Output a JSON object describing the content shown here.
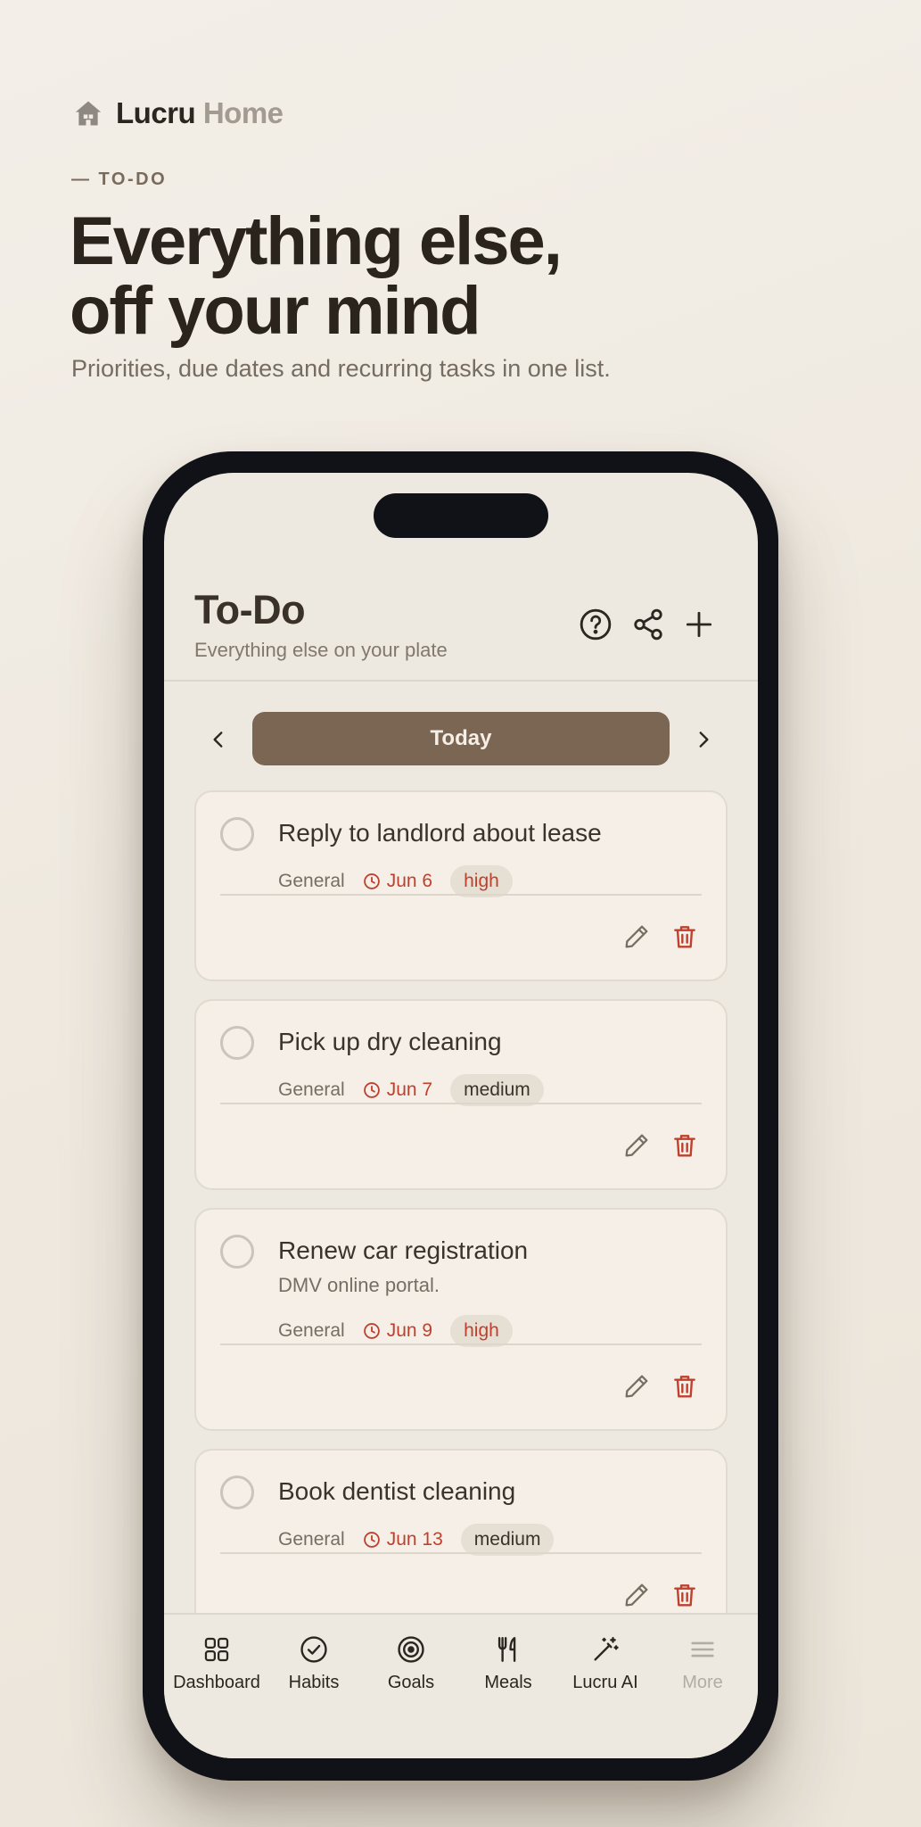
{
  "brand": {
    "name_part1": "Lucru",
    "name_part2": "Home"
  },
  "hero": {
    "eyebrow": "— TO-DO",
    "headline_line1": "Everything else,",
    "headline_line2": "off your mind",
    "subhead": "Priorities, due dates and recurring tasks in one list."
  },
  "app": {
    "title": "To-Do",
    "subtitle": "Everything else on your plate",
    "header_icons": [
      "help-icon",
      "share-icon",
      "plus-icon"
    ],
    "date_nav": {
      "label": "Today"
    },
    "tasks": [
      {
        "title": "Reply to landlord about lease",
        "note": "",
        "category": "General",
        "due": "Jun 6",
        "priority": "high"
      },
      {
        "title": "Pick up dry cleaning",
        "note": "",
        "category": "General",
        "due": "Jun 7",
        "priority": "medium"
      },
      {
        "title": "Renew car registration",
        "note": "DMV online portal.",
        "category": "General",
        "due": "Jun 9",
        "priority": "high"
      },
      {
        "title": "Book dentist cleaning",
        "note": "",
        "category": "General",
        "due": "Jun 13",
        "priority": "medium"
      }
    ],
    "tabs": [
      {
        "label": "Dashboard",
        "icon": "grid-icon"
      },
      {
        "label": "Habits",
        "icon": "check-circle-icon"
      },
      {
        "label": "Goals",
        "icon": "target-icon"
      },
      {
        "label": "Meals",
        "icon": "utensils-icon"
      },
      {
        "label": "Lucru AI",
        "icon": "magic-wand-icon"
      },
      {
        "label": "More",
        "icon": "menu-icon"
      }
    ]
  },
  "colors": {
    "accent": "#7b6654",
    "danger": "#c0402e",
    "text_dark": "#2c2620",
    "text_muted": "#776d63",
    "card_bg": "#f5efe7",
    "screen_bg": "#ede8e0"
  }
}
